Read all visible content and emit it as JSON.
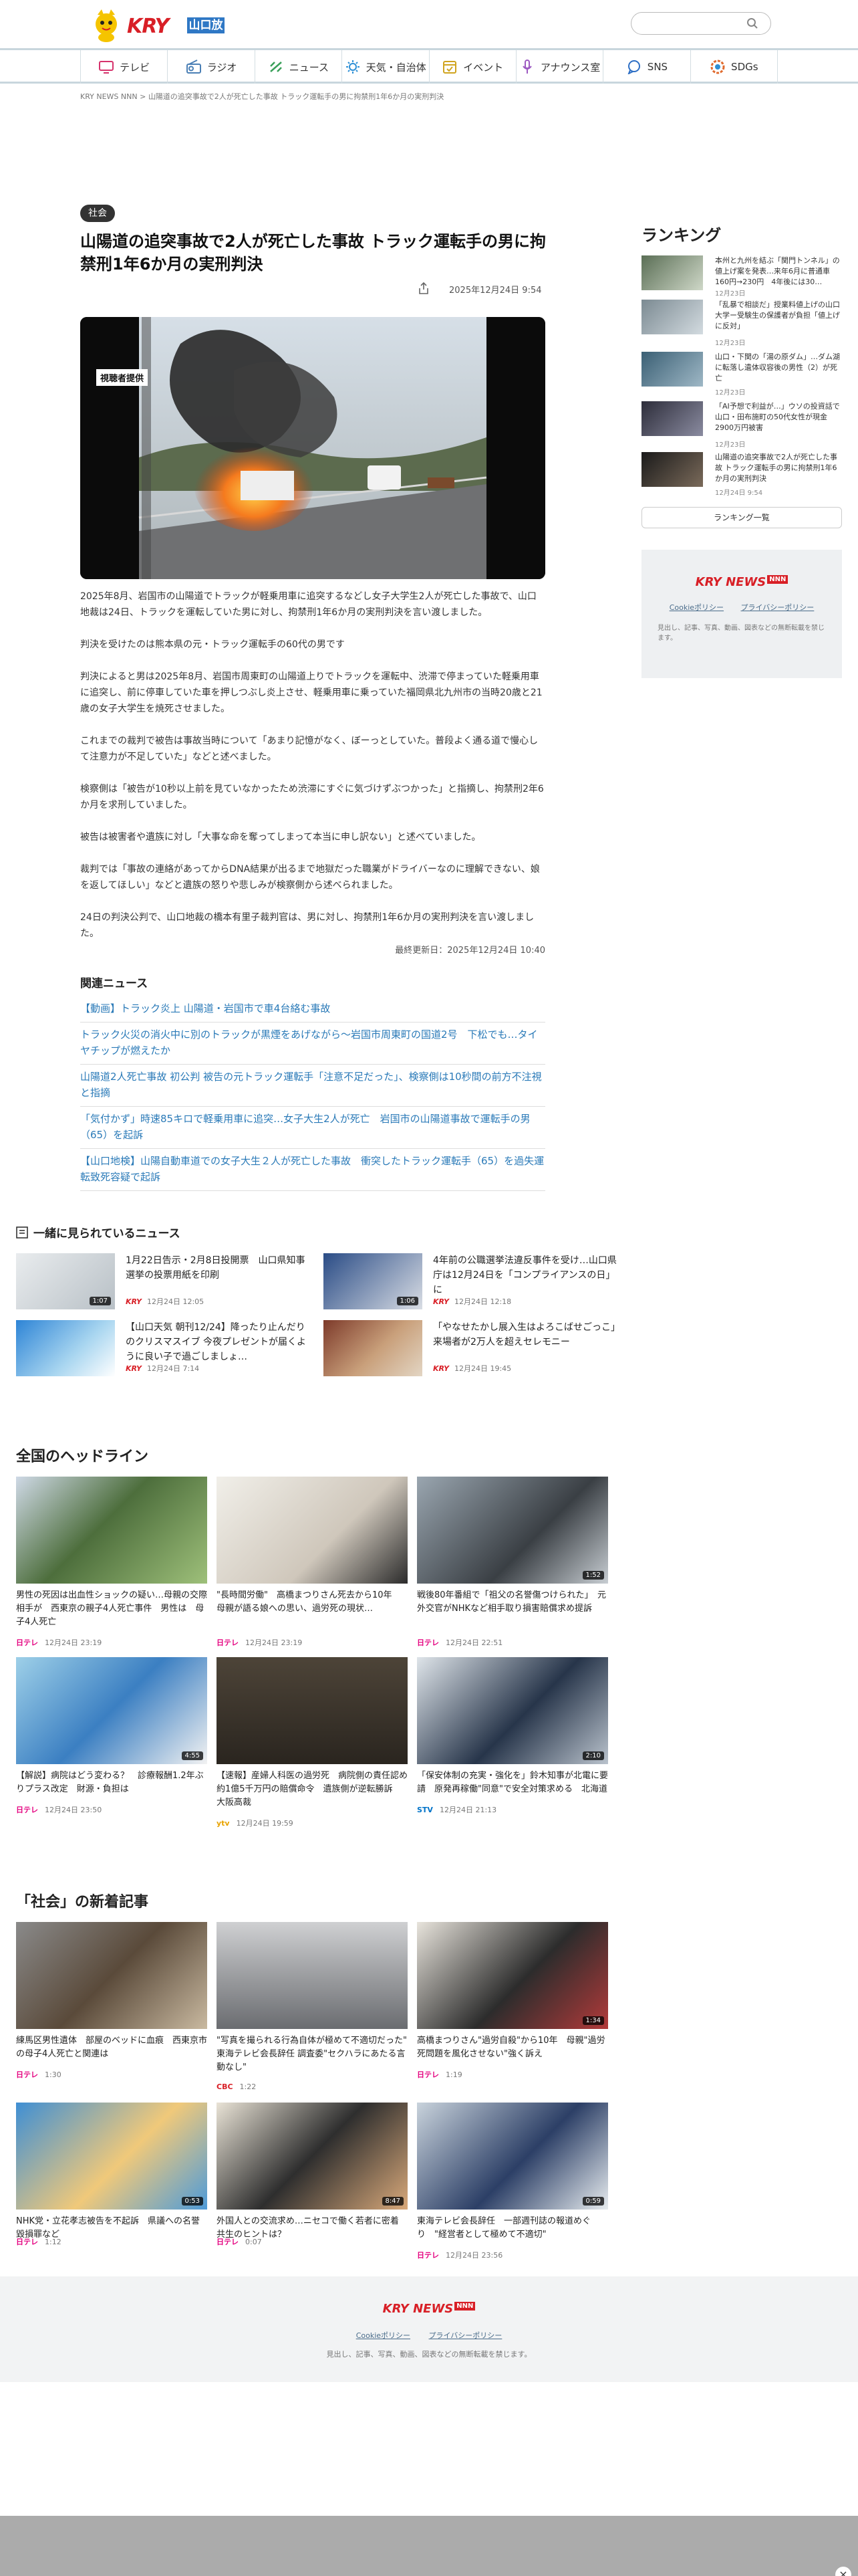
{
  "header": {
    "logo_text": "KRY",
    "logo_station": "山口放送",
    "search_placeholder": ""
  },
  "nav": [
    {
      "label": "テレビ",
      "icon": "tv-icon",
      "color": "#d6336c"
    },
    {
      "label": "ラジオ",
      "icon": "radio-icon",
      "color": "#4a7fb5"
    },
    {
      "label": "ニュース",
      "icon": "news-icon",
      "color": "#3aa05a"
    },
    {
      "label": "天気・自治体",
      "icon": "weather-icon",
      "color": "#2d8fd5"
    },
    {
      "label": "イベント",
      "icon": "calendar-icon",
      "color": "#d0a41f"
    },
    {
      "label": "アナウンス室",
      "icon": "microphone-icon",
      "color": "#9d5ac2"
    },
    {
      "label": "SNS",
      "icon": "chat-icon",
      "color": "#2d6fc5"
    },
    {
      "label": "SDGs",
      "icon": "sdgs-icon",
      "color": "#e06b2e"
    }
  ],
  "breadcrumb": {
    "home": "KRY NEWS NNN",
    "sep": ">",
    "current": "山陽道の追突事故で2人が死亡した事故 トラック運転手の男に拘禁刑1年6か月の実刑判決"
  },
  "article": {
    "tag": "社会",
    "title": "山陽道の追突事故で2人が死亡した事故 トラック運転手の男に拘禁刑1年6か月の実刑判決",
    "date": "2025年12月24日 9:54",
    "photo_credit": "視聴者提供",
    "paragraphs": [
      "2025年8月、岩国市の山陽道でトラックが軽乗用車に追突するなどし女子大学生2人が死亡した事故で、山口地裁は24日、トラックを運転していた男に対し、拘禁刑1年6か月の実刑判決を言い渡しました。",
      "判決を受けたのは熊本県の元・トラック運転手の60代の男です",
      "判決によると男は2025年8月、岩国市周東町の山陽道上りでトラックを運転中、渋滞で停まっていた軽乗用車に追突し、前に停車していた車を押しつぶし炎上させ、軽乗用車に乗っていた福岡県北九州市の当時20歳と21歳の女子大学生を焼死させました。",
      "これまでの裁判で被告は事故当時について「あまり記憶がなく、ぼーっとしていた。普段よく通る道で慢心して注意力が不足していた」などと述べました。",
      "検察側は「被告が10秒以上前を見ていなかったため渋滞にすぐに気づけずぶつかった」と指摘し、拘禁刑2年6か月を求刑していました。",
      "被告は被害者や遺族に対し「大事な命を奪ってしまって本当に申し訳ない」と述べていました。",
      "裁判では「事故の連絡があってからDNA結果が出るまで地獄だった職業がドライバーなのに理解できない、娘を返してほしい」などと遺族の怒りや悲しみが検察側から述べられました。",
      "24日の判決公判で、山口地裁の橋本有里子裁判官は、男に対し、拘禁刑1年6か月の実刑判決を言い渡しました。"
    ],
    "updated": "最終更新日：2025年12月24日 10:40"
  },
  "related": {
    "heading": "関連ニュース",
    "items": [
      "【動画】トラック炎上 山陽道・岩国市で車4台絡む事故",
      "トラック火災の消火中に別のトラックが黒煙をあげながら～岩国市周東町の国道2号　下松でも…タイヤチップが燃えたか",
      "山陽道2人死亡事故 初公判 被告の元トラック運転手「注意不足だった」、検察側は10秒間の前方不注視と指摘",
      "「気付かず」時速85キロで軽乗用車に追突…女子大生2人が死亡　岩国市の山陽道事故で運転手の男（65）を起訴",
      "【山口地検】山陽自動車道での女子大生２人が死亡した事故　衝突したトラック運転手（65）を過失運転致死容疑で起訴"
    ]
  },
  "also_seen": {
    "heading": "一緒に見られているニュース",
    "items": [
      {
        "title": "1月22日告示・2月8日投開票　山口県知事選挙の投票用紙を印刷",
        "brand": "KRY",
        "date": "12月24日 12:05",
        "duration": "1:07"
      },
      {
        "title": "4年前の公職選挙法違反事件を受け…山口県庁は12月24日を「コンプライアンスの日」に",
        "brand": "KRY",
        "date": "12月24日 12:18",
        "duration": "1:06"
      },
      {
        "title": "【山口天気 朝刊12/24】降ったり止んだりのクリスマスイブ 今夜プレゼントが届くように良い子で過ごしましょ…",
        "brand": "KRY",
        "date": "12月24日 7:14",
        "duration": ""
      },
      {
        "title": "「やなせたかし展入生はよろこばせごっこ」来場者が2万人を超えセレモニー",
        "brand": "KRY",
        "date": "12月24日 19:45",
        "duration": ""
      }
    ]
  },
  "ranking": {
    "heading": "ランキング",
    "items": [
      {
        "rank": "1",
        "title": "本州と九州を結ぶ「関門トンネル」の値上げ案を発表…来年6月に普通車160円→230円　4年後には30…",
        "date": "12月23日"
      },
      {
        "rank": "2",
        "title": "「乱暴で相談だ」授業料値上げの山口大学ー受験生の保護者が負担「値上げに反対」",
        "date": "12月23日"
      },
      {
        "rank": "3",
        "title": "山口・下関の「湯の原ダム」…ダム湖に転落し遺体収容後の男性（2）が死亡",
        "date": "12月23日"
      },
      {
        "rank": "4",
        "title": "「AI予想で利益が…」ウソの投資話で山口・田布施町の50代女性が現金2900万円被害",
        "date": "12月23日"
      },
      {
        "rank": "5",
        "title": "山陽道の追突事故で2人が死亡した事故 トラック運転手の男に拘禁刑1年6か月の実刑判決",
        "date": "12月24日 9:54"
      }
    ],
    "button": "ランキング一覧"
  },
  "promo": {
    "brand": "KRY NEWS",
    "links": [
      "Cookieポリシー",
      "プライバシーポリシー"
    ],
    "note": "見出し、記事、写真、動画、図表などの無断転載を禁じます。"
  },
  "national": {
    "heading": "全国のヘッドライン",
    "items": [
      {
        "title": "男性の死因は出血性ショックの疑い…母親の交際相手が　西東京の親子4人死亡事件　男性は　母子4人死亡",
        "channel": "日テレ",
        "date": "12月24日 23:19",
        "duration": ""
      },
      {
        "title": "\"長時間労働\"　高橋まつりさん死去から10年　母親が語る娘への思い、過労死の現状…",
        "channel": "日テレ",
        "date": "12月24日 23:19",
        "duration": ""
      },
      {
        "title": "戦後80年番組で「祖父の名誉傷つけられた」　元外交官がNHKなど相手取り損害賠償求め提訴",
        "channel": "日テレ",
        "date": "12月24日 22:51",
        "duration": "1:52"
      },
      {
        "title": "【解説】病院はどう変わる？　診療報酬1.2年ぶりプラス改定　財源・負担は",
        "channel": "日テレ",
        "date": "12月24日 23:50",
        "duration": "4:55"
      },
      {
        "title": "【速報】産婦人科医の過労死　病院側の責任認め約1億5千万円の賠償命令　遺族側が逆転勝訴　大阪高裁",
        "channel": "ytv",
        "date": "12月24日 19:59",
        "duration": ""
      },
      {
        "title": "「保安体制の充実・強化を」鈴木知事が北電に要請　原発再稼働\"同意\"で安全対策求める　北海道",
        "channel": "STV",
        "date": "12月24日 21:13",
        "duration": "2:10"
      }
    ]
  },
  "society": {
    "heading": "「社会」の新着記事",
    "items": [
      {
        "title": "練馬区男性遺体　部屋のベッドに血痕　西東京市の母子4人死亡と関連は",
        "channel": "日テレ",
        "date": "1:30",
        "duration": ""
      },
      {
        "title": "\"写真を撮られる行為自体が極めて不適切だった\" 東海テレビ会長辞任 調査委\"セクハラにあたる言動なし\"",
        "channel": "CBC",
        "date": "1:22",
        "duration": ""
      },
      {
        "title": "高橋まつりさん\"過労自殺\"から10年　母親\"過労死問題を風化させない\"強く訴え",
        "channel": "日テレ",
        "date": "1:19",
        "duration": "1:34"
      },
      {
        "title": "NHK党・立花孝志被告を不起訴　県議への名誉毀損罪など",
        "channel": "日テレ",
        "date": "1:12",
        "duration": "0:53"
      },
      {
        "title": "外国人との交流求め…ニセコで働く若者に密着　共生のヒントは？",
        "channel": "日テレ",
        "date": "0:07",
        "duration": "8:47"
      },
      {
        "title": "東海テレビ会長辞任　一部週刊誌の報道めぐり　\"経営者として極めて不適切\"",
        "channel": "日テレ",
        "date": "12月24日 23:56",
        "duration": "0:59"
      }
    ]
  },
  "footer": {
    "brand": "KRY NEWS",
    "links": [
      "Cookieポリシー",
      "プライバシーポリシー"
    ],
    "note": "見出し、記事、写真、動画、図表などの無断転載を禁じます。"
  },
  "colors": {
    "accent": "#d81f26",
    "link": "#2a7ab8",
    "nav_rule": "#c8d6dd"
  }
}
